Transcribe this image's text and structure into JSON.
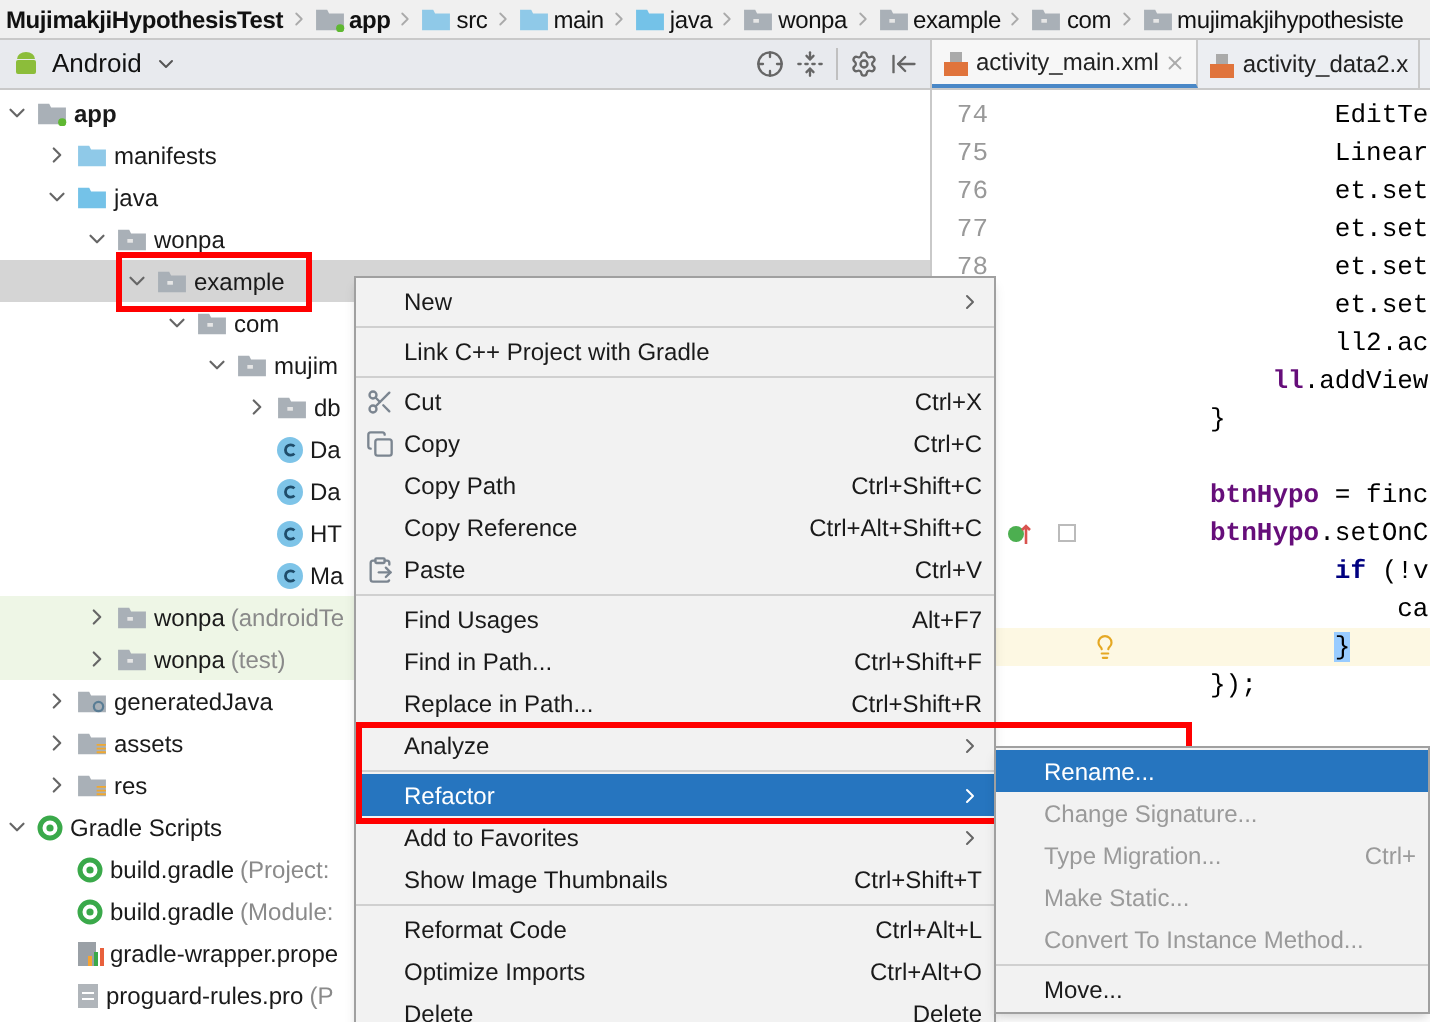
{
  "breadcrumb": [
    {
      "label": "MujimakjiHypothesisTest",
      "kind": "project"
    },
    {
      "label": "app",
      "kind": "module"
    },
    {
      "label": "src",
      "kind": "folder"
    },
    {
      "label": "main",
      "kind": "folder"
    },
    {
      "label": "java",
      "kind": "source"
    },
    {
      "label": "wonpa",
      "kind": "package"
    },
    {
      "label": "example",
      "kind": "package"
    },
    {
      "label": "com",
      "kind": "package"
    },
    {
      "label": "mujimakjihypothesiste",
      "kind": "package"
    }
  ],
  "project_panel": {
    "view": "Android",
    "tree": [
      {
        "label": "app",
        "kind": "module",
        "expanded": true,
        "selected": false,
        "children": [
          {
            "label": "manifests",
            "kind": "folder",
            "expanded": false,
            "selected": false
          },
          {
            "label": "java",
            "kind": "source",
            "expanded": true,
            "selected": false,
            "children": [
              {
                "label": "wonpa",
                "kind": "package",
                "expanded": true,
                "selected": false,
                "children": [
                  {
                    "label": "example",
                    "kind": "package",
                    "expanded": true,
                    "selected": true,
                    "children": [
                      {
                        "label": "com",
                        "kind": "package",
                        "expanded": true,
                        "selected": false,
                        "children": [
                          {
                            "label": "mujim",
                            "kind": "package",
                            "expanded": true,
                            "selected": false,
                            "children": [
                              {
                                "label": "db",
                                "kind": "package",
                                "expanded": false,
                                "selected": false
                              },
                              {
                                "label": "Da",
                                "kind": "class",
                                "selected": false
                              },
                              {
                                "label": "Da",
                                "kind": "class",
                                "selected": false
                              },
                              {
                                "label": "HT",
                                "kind": "class",
                                "selected": false
                              },
                              {
                                "label": "Ma",
                                "kind": "class",
                                "selected": false
                              }
                            ]
                          }
                        ]
                      }
                    ]
                  }
                ]
              },
              {
                "label": "wonpa",
                "note": "(androidTe",
                "kind": "test_package",
                "expanded": false,
                "selected": false
              },
              {
                "label": "wonpa",
                "note": "(test)",
                "kind": "test_package",
                "expanded": false,
                "selected": false
              }
            ]
          },
          {
            "label": "generatedJava",
            "kind": "generated",
            "expanded": false,
            "selected": false
          },
          {
            "label": "assets",
            "kind": "resources",
            "expanded": false,
            "selected": false
          },
          {
            "label": "res",
            "kind": "resources",
            "expanded": false,
            "selected": false
          }
        ]
      },
      {
        "label": "Gradle Scripts",
        "kind": "gradle",
        "expanded": true,
        "selected": false,
        "children": [
          {
            "label": "build.gradle",
            "note": "(Project:",
            "kind": "gradle",
            "selected": false
          },
          {
            "label": "build.gradle",
            "note": "(Module:",
            "kind": "gradle",
            "selected": false
          },
          {
            "label": "gradle-wrapper.prope",
            "kind": "properties",
            "selected": false
          },
          {
            "label": "proguard-rules.pro",
            "note": "(P",
            "kind": "file",
            "selected": false
          }
        ]
      }
    ]
  },
  "editor": {
    "tabs": [
      {
        "label": "activity_main.xml",
        "selected": true,
        "closable": true
      },
      {
        "label": "activity_data2.x",
        "selected": false,
        "closable": false
      }
    ],
    "lines": [
      {
        "number": "74",
        "current": false,
        "segments": [
          {
            "kind": "plain",
            "text": "        EditTe"
          }
        ]
      },
      {
        "number": "75",
        "current": false,
        "segments": [
          {
            "kind": "plain",
            "text": "        Linear"
          }
        ]
      },
      {
        "number": "76",
        "current": false,
        "segments": [
          {
            "kind": "plain",
            "text": "        et.set"
          }
        ]
      },
      {
        "number": "77",
        "current": false,
        "segments": [
          {
            "kind": "plain",
            "text": "        et.set"
          }
        ]
      },
      {
        "number": "78",
        "current": false,
        "segments": [
          {
            "kind": "plain",
            "text": "        et.set"
          }
        ]
      },
      {
        "current": false,
        "segments": [
          {
            "kind": "plain",
            "text": "        et.set"
          }
        ]
      },
      {
        "current": false,
        "segments": [
          {
            "kind": "plain",
            "text": "        ll2.ac"
          }
        ]
      },
      {
        "current": false,
        "segments": [
          {
            "kind": "field",
            "text": "    ll"
          },
          {
            "kind": "plain",
            "text": ".addView"
          }
        ]
      },
      {
        "current": false,
        "segments": [
          {
            "kind": "plain",
            "text": "}"
          }
        ]
      },
      {
        "kind": "blank"
      },
      {
        "current": false,
        "segments": [
          {
            "kind": "field",
            "text": "btnHypo"
          },
          {
            "kind": "plain",
            "text": " = finc"
          }
        ]
      },
      {
        "current": false,
        "kind": "implements",
        "fold": true,
        "segments": [
          {
            "kind": "field",
            "text": "btnHypo"
          },
          {
            "kind": "plain",
            "text": ".setOnC"
          }
        ]
      },
      {
        "current": false,
        "segments": [
          {
            "kind": "keyword",
            "text": "        if"
          },
          {
            "kind": "plain",
            "text": " (!v"
          }
        ]
      },
      {
        "current": false,
        "segments": [
          {
            "kind": "plain",
            "text": "            ca"
          }
        ]
      },
      {
        "current": true,
        "kind": "bulb",
        "segments": [
          {
            "kind": "brace",
            "text": "        }"
          }
        ]
      },
      {
        "current": false,
        "segments": [
          {
            "kind": "plain",
            "text": "});"
          }
        ]
      }
    ]
  },
  "context_menu": [
    {
      "kind": "item",
      "label": "New",
      "submenu": true,
      "selected": false
    },
    {
      "kind": "separator"
    },
    {
      "kind": "item",
      "label": "Link C++ Project with Gradle",
      "submenu": false,
      "selected": false
    },
    {
      "kind": "separator"
    },
    {
      "kind": "item",
      "label": "Cut",
      "shortcut": "Ctrl+X",
      "submenu": false,
      "selected": false
    },
    {
      "kind": "item",
      "label": "Copy",
      "shortcut": "Ctrl+C",
      "submenu": false,
      "selected": false
    },
    {
      "kind": "item",
      "label": "Copy Path",
      "shortcut": "Ctrl+Shift+C",
      "submenu": false,
      "selected": false
    },
    {
      "kind": "item",
      "label": "Copy Reference",
      "shortcut": "Ctrl+Alt+Shift+C",
      "submenu": false,
      "selected": false
    },
    {
      "kind": "item",
      "label": "Paste",
      "shortcut": "Ctrl+V",
      "submenu": false,
      "selected": false
    },
    {
      "kind": "separator"
    },
    {
      "kind": "item",
      "label": "Find Usages",
      "shortcut": "Alt+F7",
      "submenu": false,
      "selected": false
    },
    {
      "kind": "item",
      "label": "Find in Path...",
      "shortcut": "Ctrl+Shift+F",
      "submenu": false,
      "selected": false
    },
    {
      "kind": "item",
      "label": "Replace in Path...",
      "shortcut": "Ctrl+Shift+R",
      "submenu": false,
      "selected": false
    },
    {
      "kind": "item",
      "label": "Analyze",
      "submenu": true,
      "selected": false
    },
    {
      "kind": "separator"
    },
    {
      "kind": "item",
      "label": "Refactor",
      "submenu": true,
      "selected": true
    },
    {
      "kind": "item",
      "label": "Add to Favorites",
      "submenu": true,
      "selected": false
    },
    {
      "kind": "item",
      "label": "Show Image Thumbnails",
      "shortcut": "Ctrl+Shift+T",
      "submenu": false,
      "selected": false
    },
    {
      "kind": "separator"
    },
    {
      "kind": "item",
      "label": "Reformat Code",
      "shortcut": "Ctrl+Alt+L",
      "submenu": false,
      "selected": false
    },
    {
      "kind": "item",
      "label": "Optimize Imports",
      "shortcut": "Ctrl+Alt+O",
      "submenu": false,
      "selected": false
    },
    {
      "kind": "item",
      "label": "Delete",
      "shortcut": "Delete",
      "submenu": false,
      "selected": false
    }
  ],
  "refactor_submenu": [
    {
      "kind": "item",
      "label": "Rename...",
      "selected": true,
      "disabled": false
    },
    {
      "kind": "item",
      "label": "Change Signature...",
      "selected": false,
      "disabled": true
    },
    {
      "kind": "item",
      "label": "Type Migration...",
      "shortcut": "Ctrl+",
      "selected": false,
      "disabled": true
    },
    {
      "kind": "item",
      "label": "Make Static...",
      "selected": false,
      "disabled": true
    },
    {
      "kind": "item",
      "label": "Convert To Instance Method...",
      "selected": false,
      "disabled": true
    },
    {
      "kind": "separator"
    },
    {
      "kind": "item",
      "label": "Move...",
      "selected": false,
      "disabled": false
    }
  ]
}
